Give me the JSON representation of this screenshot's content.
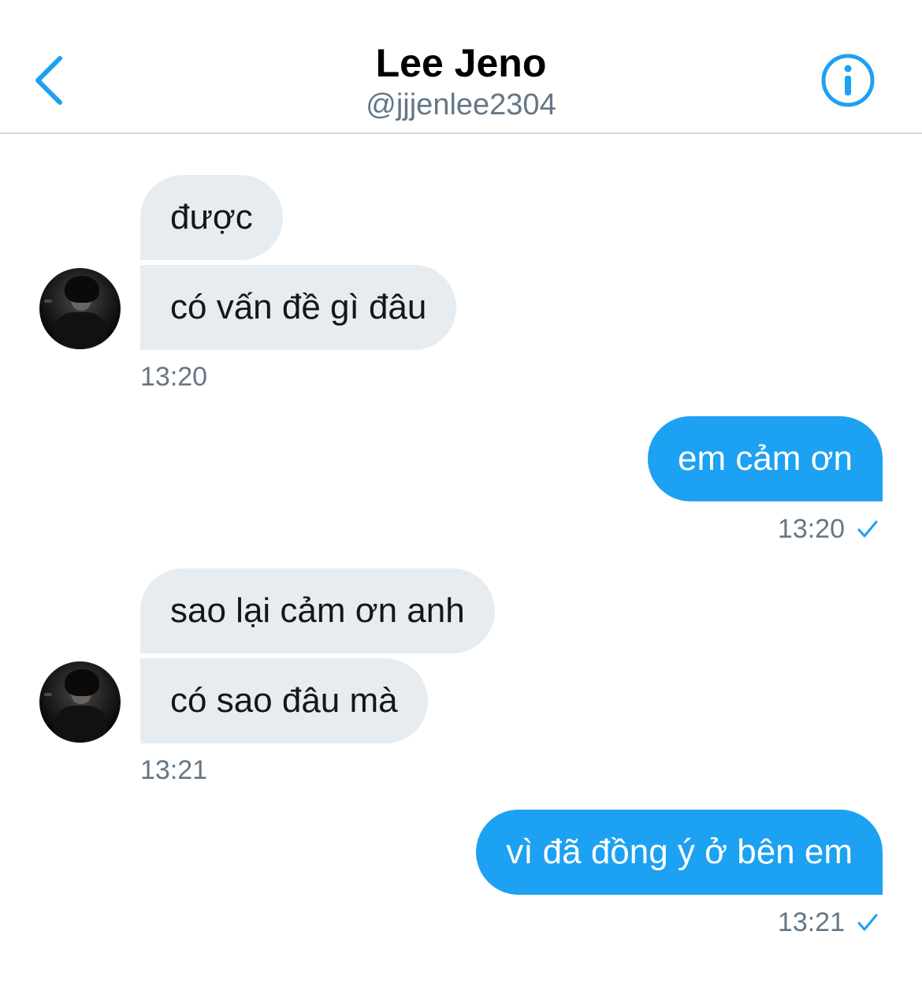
{
  "header": {
    "title": "Lee Jeno",
    "handle": "@jjjenlee2304",
    "back_icon": "chevron-left-icon",
    "info_icon": "info-icon",
    "accent_color": "#1da1f2"
  },
  "messages": [
    {
      "text": "được",
      "direction": "incoming"
    },
    {
      "text": "có vấn đề gì đâu",
      "direction": "incoming"
    },
    {
      "text": "em cảm ơn",
      "direction": "outgoing"
    },
    {
      "text": "sao lại cảm ơn anh",
      "direction": "incoming"
    },
    {
      "text": "có sao đâu mà",
      "direction": "incoming"
    },
    {
      "text": "vì đã đồng ý ở bên em",
      "direction": "outgoing"
    }
  ],
  "timestamps": {
    "group1": "13:20",
    "group2": "13:20",
    "group3": "13:21",
    "group4": "13:21"
  },
  "colors": {
    "incoming_bubble": "#e6ecf0",
    "outgoing_bubble": "#1da1f2",
    "timestamp_text": "#657786"
  }
}
